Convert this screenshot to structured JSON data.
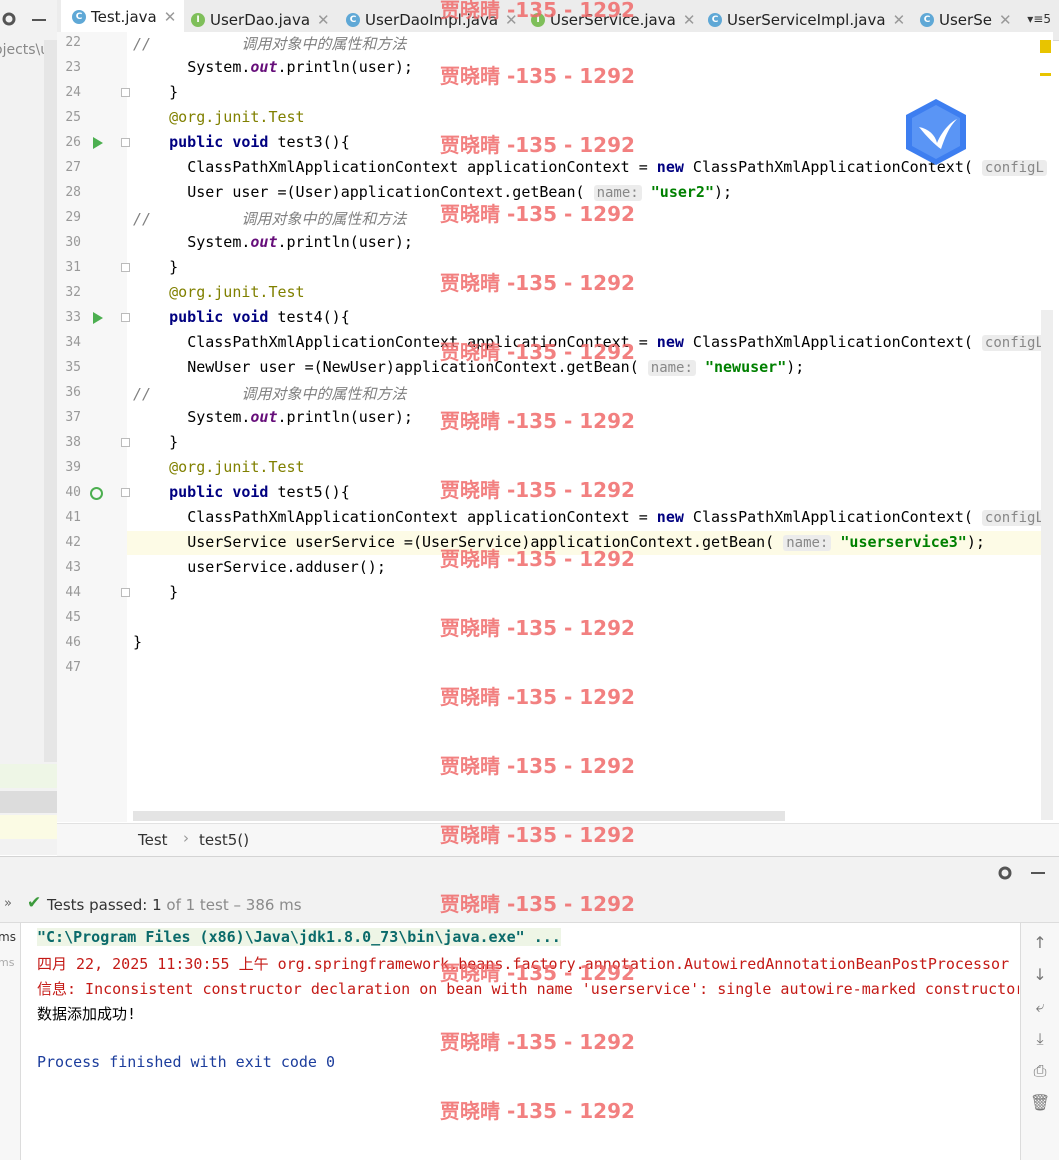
{
  "left_panel": {
    "partial_text": "ojects\\u"
  },
  "tabs": [
    {
      "label": "Test.java",
      "icon": "class-file-icon",
      "active": true
    },
    {
      "label": "UserDao.java",
      "icon": "interface-file-icon"
    },
    {
      "label": "UserDaoImpl.java",
      "icon": "class-file-icon"
    },
    {
      "label": "UserService.java",
      "icon": "interface-file-icon"
    },
    {
      "label": "UserServiceImpl.java",
      "icon": "class-file-icon"
    },
    {
      "label": "UserSe",
      "icon": "class-file-icon"
    }
  ],
  "tab_count": "5",
  "editor": {
    "line_numbers": [
      "22",
      "23",
      "24",
      "25",
      "26",
      "27",
      "28",
      "29",
      "30",
      "31",
      "32",
      "33",
      "34",
      "35",
      "36",
      "37",
      "38",
      "39",
      "40",
      "41",
      "42",
      "43",
      "44",
      "45",
      "46",
      "47"
    ],
    "comment_text": "调用对象中的属性和方法",
    "code": {
      "println": "System.",
      "out": "out",
      "println_tail": ".println(user);",
      "close_brace": "}",
      "annotation_prefix": "@org.junit.",
      "annotation_test": "Test",
      "kw_public": "public",
      "kw_void": "void",
      "kw_new": "new",
      "test3_sig": " test3(){",
      "test4_sig": " test4(){",
      "test5_sig": " test5(){",
      "ctx_decl": "ClassPathXmlApplicationContext applicationContext = ",
      "ctx_new": " ClassPathXmlApplicationContext(",
      "ctx_hint": "configL",
      "line28_a": "User user =(User)applicationContext.getBean(",
      "hint_name": "name:",
      "str_user2": "\"user2\"",
      "line_end": ");",
      "line35_a": "NewUser user =(NewUser)applicationContext.getBean(",
      "str_newuser": "\"newuser\"",
      "line42_a": "UserService userService =(UserService)applicationContext.getBean(",
      "str_userservice3": "\"userservice3\"",
      "line43": "userService.adduser();",
      "comment_slashes": "//"
    }
  },
  "breadcrumb": {
    "item1": "Test",
    "separator": "›",
    "item2": "test5()"
  },
  "run": {
    "tests_passed_label": "Tests passed:",
    "tests_passed_count": "1",
    "tests_total": "of 1 test",
    "duration": "– 386 ms",
    "left_ms1": "ms",
    "left_ms2": "ms",
    "console": {
      "line1": "\"C:\\Program Files (x86)\\Java\\jdk1.8.0_73\\bin\\java.exe\" ...",
      "line2": "四月 22, 2025 11:30:55 上午 org.springframework.beans.factory.annotation.AutowiredAnnotationBeanPostProcessor",
      "line3": "信息: Inconsistent constructor declaration on bean with name 'userservice': single autowire-marked constructor",
      "line4": "数据添加成功!",
      "line5": "Process finished with exit code 0"
    }
  },
  "watermark": "贾晓晴 -135 - 1292",
  "colors": {
    "keyword": "#000080",
    "string": "#008000",
    "annotation": "#808000",
    "comment": "#808080",
    "error": "#c41a16",
    "success": "#3c9a3c",
    "watermark": "#f06a6a"
  }
}
